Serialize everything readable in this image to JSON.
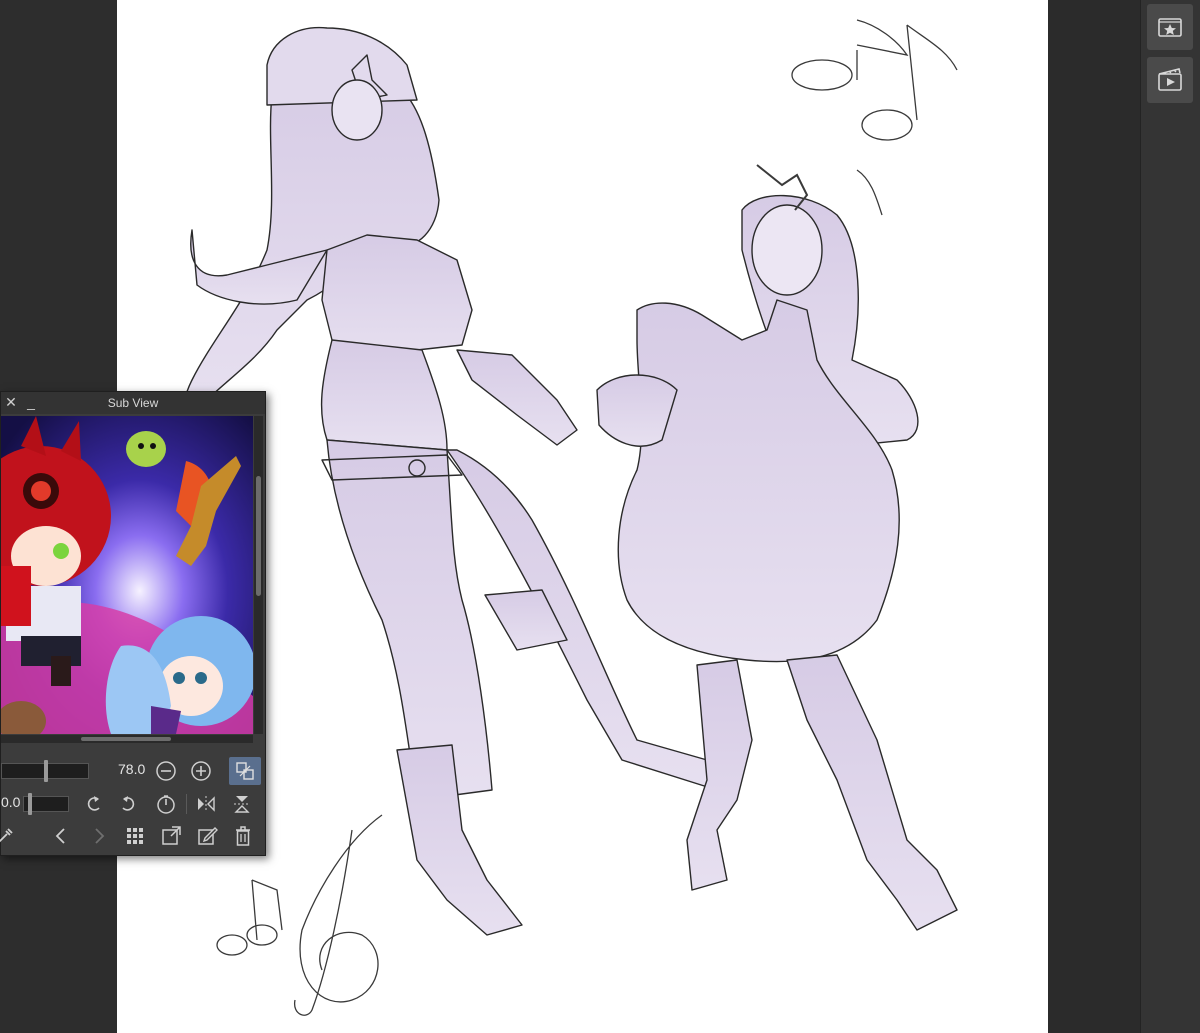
{
  "subview": {
    "title": "Sub View",
    "zoom_value": "78.0",
    "rotation_value": "0.0"
  },
  "icons": {
    "right_panel": [
      "material-folder-star-icon",
      "animation-clapper-icon"
    ],
    "subview_controls": [
      "zoom-out-icon",
      "zoom-in-icon",
      "fit-view-icon",
      "rotate-left-icon",
      "rotate-right-icon",
      "reset-rotation-icon",
      "flip-horizontal-icon",
      "flip-vertical-icon",
      "eyedropper-icon",
      "previous-icon",
      "next-icon",
      "grid-icon",
      "import-image-icon",
      "edit-icon",
      "delete-icon"
    ]
  },
  "colors": {
    "canvas": "#ffffff",
    "workspace": "#2d2d2d",
    "sketch_fill": "#d9cfe6",
    "line_art": "#2a2a2a",
    "active_button": "#5a6f8e"
  }
}
